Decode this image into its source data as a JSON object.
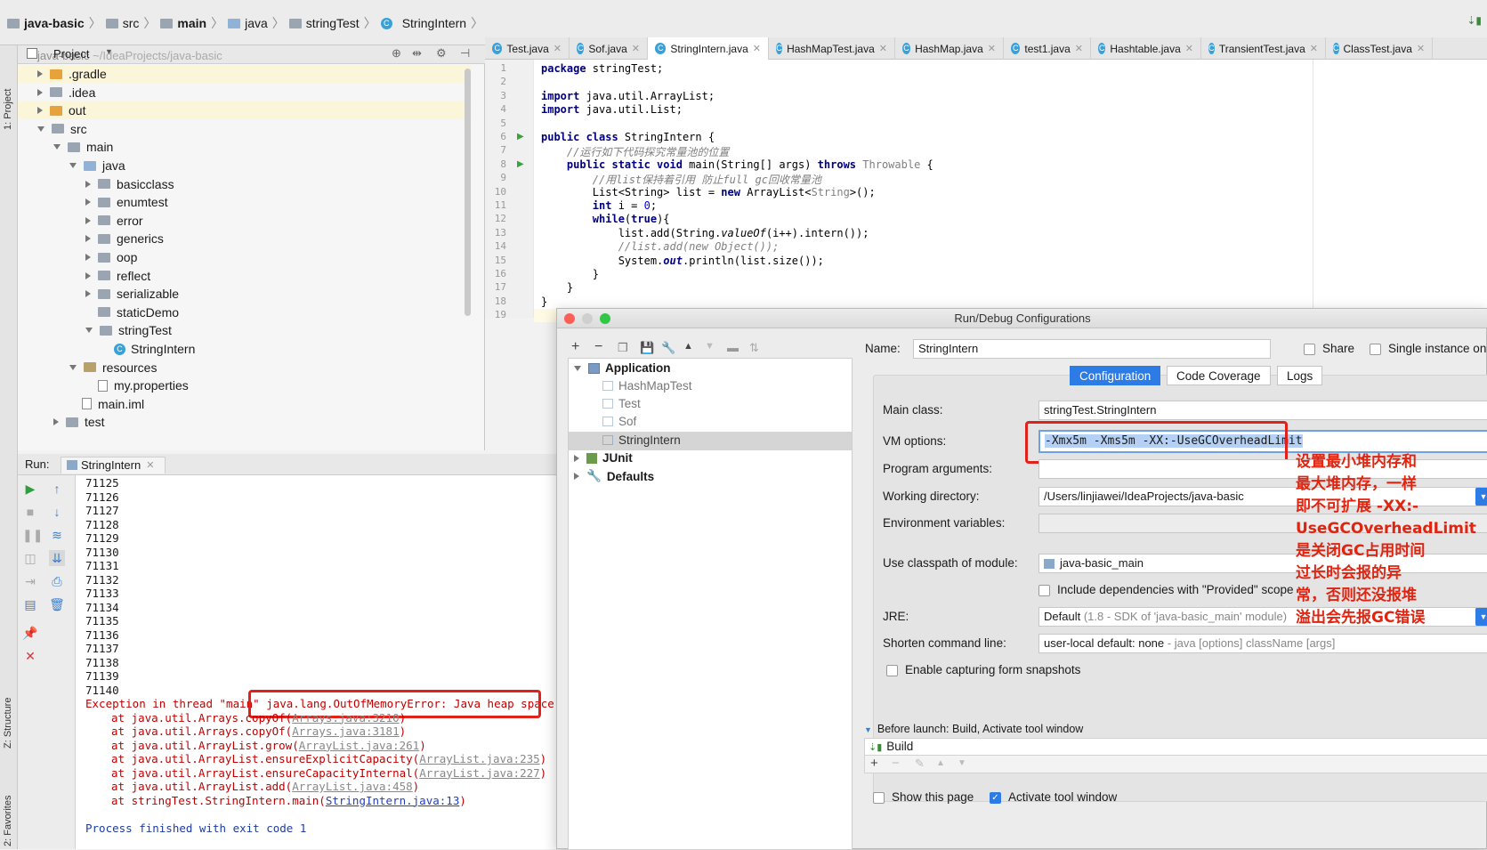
{
  "breadcrumb": [
    "java-basic",
    "src",
    "main",
    "java",
    "stringTest",
    "StringIntern"
  ],
  "project": {
    "header": "Project",
    "root_label": "java-basic",
    "root_path": "~/IdeaProjects/java-basic",
    "tree": [
      {
        "label": ".gradle",
        "level": 1,
        "kind": "folder-orange",
        "state": "closed",
        "hl": true
      },
      {
        "label": ".idea",
        "level": 1,
        "kind": "folder-gray",
        "state": "closed",
        "hl": false
      },
      {
        "label": "out",
        "level": 1,
        "kind": "folder-orange",
        "state": "closed",
        "hl": true
      },
      {
        "label": "src",
        "level": 1,
        "kind": "folder-gray",
        "state": "open",
        "hl": false
      },
      {
        "label": "main",
        "level": 2,
        "kind": "folder-gray",
        "state": "open",
        "hl": false
      },
      {
        "label": "java",
        "level": 3,
        "kind": "folder-blue",
        "state": "open",
        "hl": false
      },
      {
        "label": "basicclass",
        "level": 4,
        "kind": "package",
        "state": "closed",
        "hl": false
      },
      {
        "label": "enumtest",
        "level": 4,
        "kind": "package",
        "state": "closed",
        "hl": false
      },
      {
        "label": "error",
        "level": 4,
        "kind": "package",
        "state": "closed",
        "hl": false
      },
      {
        "label": "generics",
        "level": 4,
        "kind": "package",
        "state": "closed",
        "hl": false
      },
      {
        "label": "oop",
        "level": 4,
        "kind": "package",
        "state": "closed",
        "hl": false
      },
      {
        "label": "reflect",
        "level": 4,
        "kind": "package",
        "state": "closed",
        "hl": false
      },
      {
        "label": "serializable",
        "level": 4,
        "kind": "package",
        "state": "closed",
        "hl": false
      },
      {
        "label": "staticDemo",
        "level": 4,
        "kind": "package",
        "state": "none",
        "hl": false
      },
      {
        "label": "stringTest",
        "level": 4,
        "kind": "package",
        "state": "open",
        "hl": false
      },
      {
        "label": "StringIntern",
        "level": 5,
        "kind": "class",
        "state": "none",
        "hl": false
      },
      {
        "label": "resources",
        "level": 3,
        "kind": "folder-res",
        "state": "open",
        "hl": false
      },
      {
        "label": "my.properties",
        "level": 4,
        "kind": "file",
        "state": "none",
        "hl": false
      },
      {
        "label": "main.iml",
        "level": 3,
        "kind": "file",
        "state": "none",
        "hl": false
      },
      {
        "label": "test",
        "level": 2,
        "kind": "folder-gray",
        "state": "closed",
        "hl": false
      }
    ]
  },
  "left_strip": {
    "project": "1: Project",
    "structure": "Z: Structure",
    "favorites": "2: Favorites"
  },
  "editor_tabs": [
    "Test.java",
    "Sof.java",
    "StringIntern.java",
    "HashMapTest.java",
    "HashMap.java",
    "test1.java",
    "Hashtable.java",
    "TransientTest.java",
    "ClassTest.java"
  ],
  "active_tab": "StringIntern.java",
  "code_lines": [
    {
      "n": "1",
      "html": "<span class='kw'>package</span> stringTest;"
    },
    {
      "n": "2",
      "html": ""
    },
    {
      "n": "3",
      "html": "<span class='kw'>import</span> java.util.ArrayList;"
    },
    {
      "n": "4",
      "html": "<span class='kw'>import</span> java.util.List;"
    },
    {
      "n": "5",
      "html": ""
    },
    {
      "n": "6",
      "html": "<span class='kw'>public class</span> StringIntern {"
    },
    {
      "n": "7",
      "html": "    <span class='cm'>//运行如下代码探究常量池的位置</span>"
    },
    {
      "n": "8",
      "html": "    <span class='kw'>public static void</span> main(String[] args) <span class='kw'>throws</span> <span class='gtype'>Throwable</span> {"
    },
    {
      "n": "9",
      "html": "        <span class='cm'>//用list保持着引用 防止full gc回收常量池</span>"
    },
    {
      "n": "10",
      "html": "        List&lt;String&gt; list = <span class='kw'>new</span> ArrayList&lt;<span class='gtype'>String</span>&gt;();"
    },
    {
      "n": "11",
      "html": "        <span class='kw'>int</span> i = <span class='num'>0</span>;"
    },
    {
      "n": "12",
      "html": "        <span class='kw'>while</span>(<span class='kw'>true</span>){"
    },
    {
      "n": "13",
      "html": "            list.add(String.<i>valueOf</i>(i++).intern());"
    },
    {
      "n": "14",
      "html": "            <span class='cm'>//list.add(new Object());</span>"
    },
    {
      "n": "15",
      "html": "            System.<i class='kw' style='font-weight:bold'>out</i>.println(list.size());"
    },
    {
      "n": "16",
      "html": "        }"
    },
    {
      "n": "17",
      "html": "    }"
    },
    {
      "n": "18",
      "html": "}"
    },
    {
      "n": "19",
      "html": ""
    }
  ],
  "run": {
    "label": "Run:",
    "tab": "StringIntern",
    "output_numbers": [
      "71125",
      "71126",
      "71127",
      "71128",
      "71129",
      "71130",
      "71131",
      "71132",
      "71133",
      "71134",
      "71135",
      "71136",
      "71137",
      "71138",
      "71139",
      "71140"
    ],
    "exception_prefix": "Exception in thread \"main\" ",
    "exception_msg": "java.lang.OutOfMemoryError: Java heap space",
    "stack": [
      {
        "pre": "at java.util.Arrays.copyOf(",
        "link": "Arrays.java:3210",
        "post": ")"
      },
      {
        "pre": "at java.util.Arrays.copyOf(",
        "link": "Arrays.java:3181",
        "post": ")"
      },
      {
        "pre": "at java.util.ArrayList.grow(",
        "link": "ArrayList.java:261",
        "post": ")"
      },
      {
        "pre": "at java.util.ArrayList.ensureExplicitCapacity(",
        "link": "ArrayList.java:235",
        "post": ")"
      },
      {
        "pre": "at java.util.ArrayList.ensureCapacityInternal(",
        "link": "ArrayList.java:227",
        "post": ")"
      },
      {
        "pre": "at java.util.ArrayList.add(",
        "link": "ArrayList.java:458",
        "post": ")"
      },
      {
        "pre": "at stringTest.StringIntern.main(",
        "link": "StringIntern.java:13",
        "post": ")"
      }
    ],
    "finished": "Process finished with exit code 1"
  },
  "dialog": {
    "title": "Run/Debug Configurations",
    "tree": {
      "application": "Application",
      "children": [
        "HashMapTest",
        "Test",
        "Sof",
        "StringIntern"
      ],
      "junit": "JUnit",
      "defaults": "Defaults"
    },
    "name_label": "Name:",
    "name_value": "StringIntern",
    "share": "Share",
    "single_instance": "Single instance only",
    "tabs": [
      "Configuration",
      "Code Coverage",
      "Logs"
    ],
    "main_class_label": "Main class:",
    "main_class": "stringTest.StringIntern",
    "vm_label": "VM options:",
    "vm_value": "-Xmx5m -Xms5m -XX:-UseGCOverheadLimit",
    "prog_args_label": "Program arguments:",
    "workdir_label": "Working directory:",
    "workdir": "/Users/linjiawei/IdeaProjects/java-basic",
    "env_label": "Environment variables:",
    "classpath_label": "Use classpath of module:",
    "classpath_module": "java-basic_main",
    "include_deps": "Include dependencies with \"Provided\" scope",
    "jre_label": "JRE:",
    "jre_value": "Default",
    "jre_detail": "(1.8 - SDK of 'java-basic_main' module)",
    "shorten_label": "Shorten command line:",
    "shorten_value": "user-local default: none",
    "shorten_detail": "- java [options] className [args]",
    "snapshots": "Enable capturing form snapshots",
    "before_launch": "Before launch: Build, Activate tool window",
    "build": "Build",
    "show_page": "Show this page",
    "activate_tool": "Activate tool window",
    "annotation": "设置最小堆内存和最大堆内存，一样即不可扩展 -XX:-UseGCOverheadLimit是关闭GC占用时间过长时会报的异常，否则还没报堆溢出会先报GC错误"
  },
  "colors": {
    "accent": "#2d7be5",
    "highlight_box": "#e0231a",
    "error_text": "#c00000"
  }
}
